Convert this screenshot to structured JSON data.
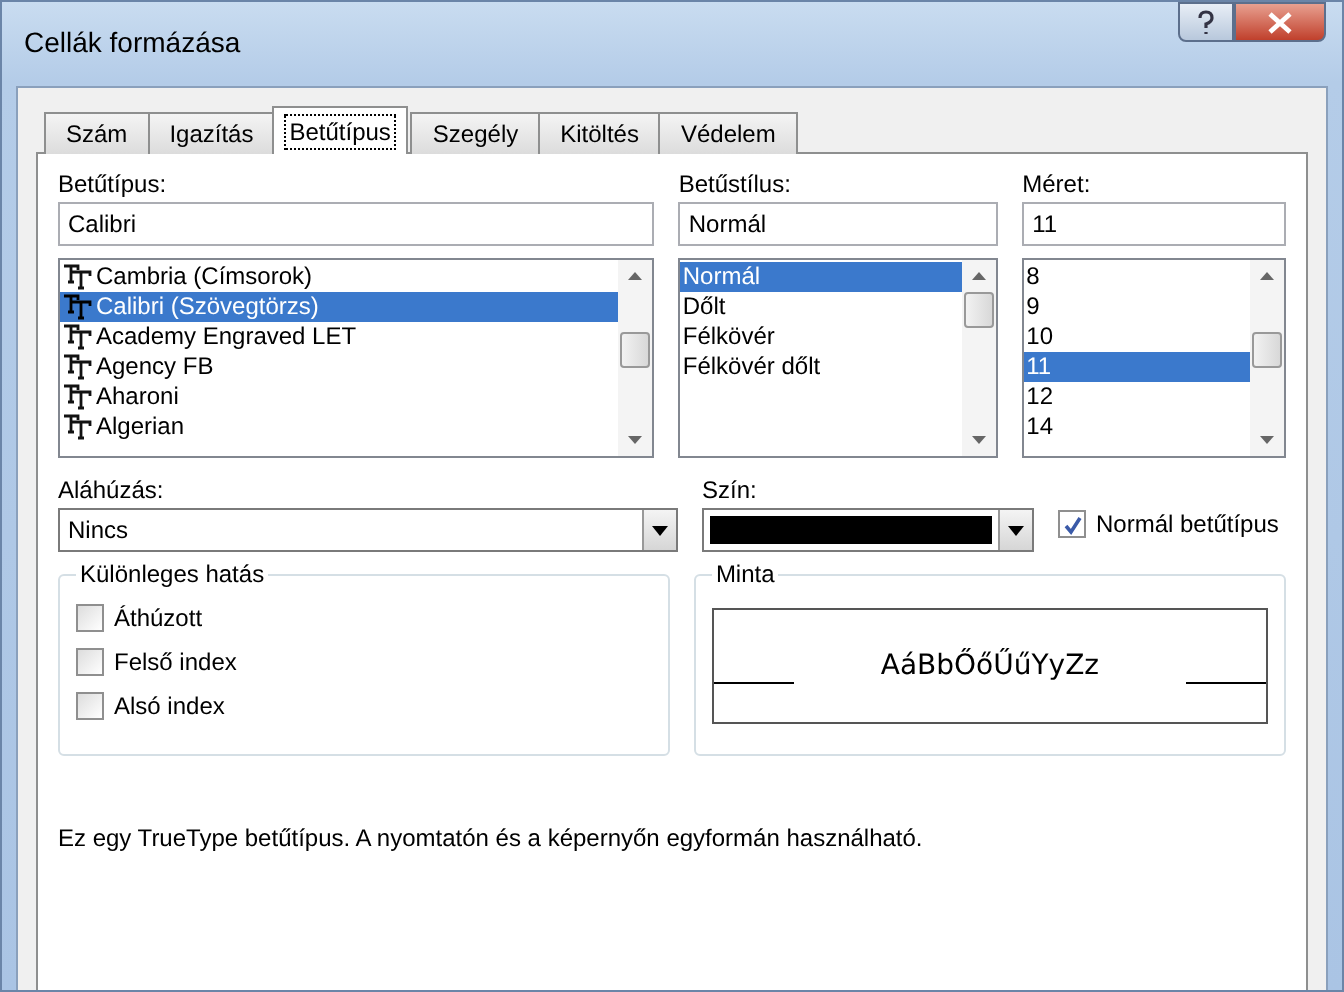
{
  "window": {
    "title": "Cellák formázása"
  },
  "tabs": [
    {
      "label": "Szám",
      "selected": false
    },
    {
      "label": "Igazítás",
      "selected": false
    },
    {
      "label": "Betűtípus",
      "selected": true
    },
    {
      "label": "Szegély",
      "selected": false
    },
    {
      "label": "Kitöltés",
      "selected": false
    },
    {
      "label": "Védelem",
      "selected": false
    }
  ],
  "font": {
    "label": "Betűtípus:",
    "value": "Calibri",
    "items": [
      {
        "label": "Cambria (Címsorok)",
        "selected": false
      },
      {
        "label": "Calibri (Szövegtörzs)",
        "selected": true
      },
      {
        "label": "Academy Engraved LET",
        "selected": false
      },
      {
        "label": "Agency FB",
        "selected": false
      },
      {
        "label": "Aharoni",
        "selected": false
      },
      {
        "label": "Algerian",
        "selected": false
      }
    ]
  },
  "style": {
    "label": "Betűstílus:",
    "value": "Normál",
    "items": [
      {
        "label": "Normál",
        "selected": true
      },
      {
        "label": "Dőlt",
        "selected": false
      },
      {
        "label": "Félkövér",
        "selected": false
      },
      {
        "label": "Félkövér dőlt",
        "selected": false
      }
    ]
  },
  "size": {
    "label": "Méret:",
    "value": "11",
    "items": [
      {
        "label": "8",
        "selected": false
      },
      {
        "label": "9",
        "selected": false
      },
      {
        "label": "10",
        "selected": false
      },
      {
        "label": "11",
        "selected": true
      },
      {
        "label": "12",
        "selected": false
      },
      {
        "label": "14",
        "selected": false
      }
    ]
  },
  "underline": {
    "label": "Aláhúzás:",
    "value": "Nincs"
  },
  "color": {
    "label": "Szín:",
    "color": "#000000"
  },
  "normal_font": {
    "label": "Normál betűtípus",
    "checked": true
  },
  "effects": {
    "title": "Különleges hatás",
    "items": [
      {
        "label": "Áthúzott",
        "checked": false
      },
      {
        "label": "Felső index",
        "checked": false
      },
      {
        "label": "Alsó index",
        "checked": false
      }
    ]
  },
  "preview": {
    "title": "Minta",
    "sample": "AáBbŐőŰűYyZz"
  },
  "description": "Ez egy TrueType betűtípus.  A nyomtatón és a képernyőn egyformán használható."
}
